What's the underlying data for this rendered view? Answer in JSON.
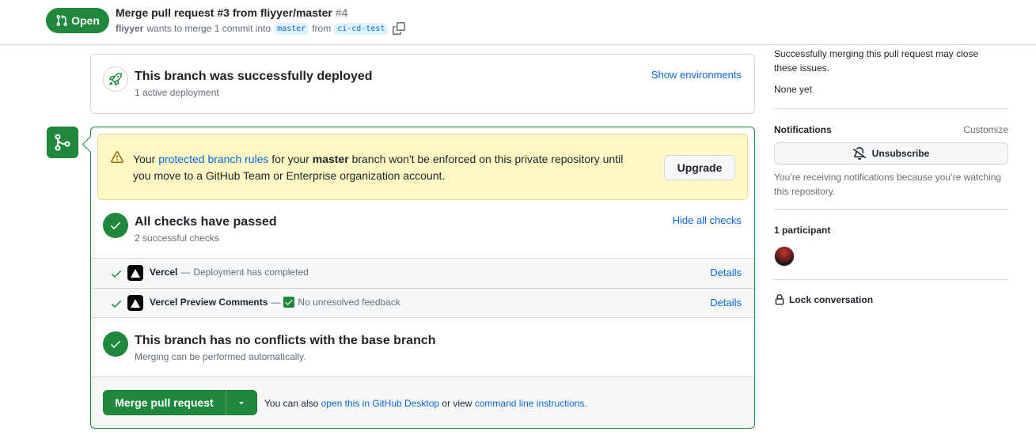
{
  "header": {
    "state": "Open",
    "title": "Merge pull request #3 from fliyyer/master",
    "number": "#4",
    "author": "fliyyer",
    "meta_mid": "wants to merge 1 commit into",
    "base_branch": "master",
    "meta_from": "from",
    "head_branch": "ci-cd-test"
  },
  "deploy": {
    "title": "This branch was successfully deployed",
    "subtitle": "1 active deployment",
    "link": "Show environments"
  },
  "warning": {
    "prefix": "Your",
    "link": "protected branch rules",
    "mid": "for your",
    "branch": "master",
    "suffix": "branch won't be enforced on this private repository until you move to a GitHub Team or Enterprise organization account.",
    "button": "Upgrade"
  },
  "checks": {
    "title": "All checks have passed",
    "subtitle": "2 successful checks",
    "link": "Hide all checks",
    "rows": [
      {
        "name": "Vercel",
        "sep": "—",
        "status": "Deployment has completed",
        "details": "Details"
      },
      {
        "name": "Vercel Preview Comments",
        "sep": "—",
        "status": "No unresolved feedback",
        "details": "Details"
      }
    ]
  },
  "conflicts": {
    "title": "This branch has no conflicts with the base branch",
    "subtitle": "Merging can be performed automatically."
  },
  "merge": {
    "button": "Merge pull request",
    "text_prefix": "You can also",
    "link1": "open this in GitHub Desktop",
    "text_mid": "or view",
    "link2": "command line instructions",
    "text_suffix": "."
  },
  "sidebar": {
    "close_text": "Successfully merging this pull request may close these issues.",
    "none_yet": "None yet",
    "notifications_heading": "Notifications",
    "customize": "Customize",
    "unsubscribe": "Unsubscribe",
    "notif_reason": "You’re receiving notifications because you’re watching this repository.",
    "participants_heading": "1 participant",
    "lock": "Lock conversation"
  },
  "colors": {
    "success": "#1f883d",
    "link": "#0969da",
    "warning_bg": "#fff8c5",
    "muted": "#656d76"
  },
  "icons": [
    "git-pull-request-icon",
    "copy-icon",
    "rocket-icon",
    "git-merge-icon",
    "alert-icon",
    "check-circle-icon",
    "check-icon",
    "vercel-icon",
    "triangle-down-icon",
    "bell-slash-icon",
    "lock-icon"
  ]
}
